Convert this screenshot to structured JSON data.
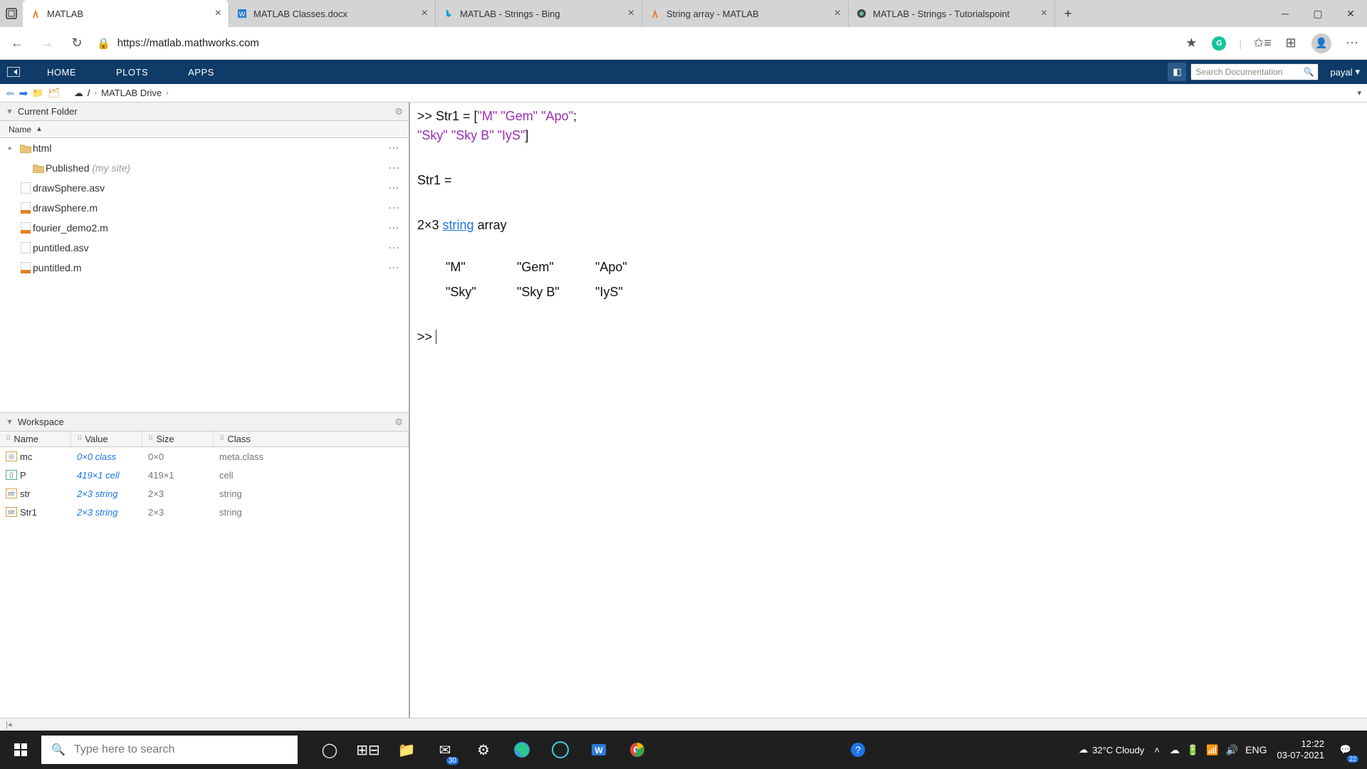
{
  "browser": {
    "tabs": [
      {
        "title": "MATLAB",
        "active": true
      },
      {
        "title": "MATLAB Classes.docx",
        "active": false
      },
      {
        "title": "MATLAB - Strings - Bing",
        "active": false
      },
      {
        "title": "String array - MATLAB",
        "active": false
      },
      {
        "title": "MATLAB - Strings - Tutorialspoint",
        "active": false
      }
    ],
    "url": "https://matlab.mathworks.com"
  },
  "matlab": {
    "tabs": [
      "HOME",
      "PLOTS",
      "APPS"
    ],
    "search_placeholder": "Search Documentation",
    "user": "payal",
    "breadcrumb": "MATLAB Drive"
  },
  "panels": {
    "current_folder": {
      "title": "Current Folder",
      "column": "Name"
    },
    "workspace": {
      "title": "Workspace",
      "columns": [
        "Name",
        "Value",
        "Size",
        "Class"
      ]
    }
  },
  "files": [
    {
      "name": "html",
      "type": "folder",
      "expandable": true
    },
    {
      "name": "Published",
      "hint": "(my site)",
      "type": "folder",
      "expandable": false,
      "indent": true
    },
    {
      "name": "drawSphere.asv",
      "type": "file"
    },
    {
      "name": "drawSphere.m",
      "type": "m"
    },
    {
      "name": "fourier_demo2.m",
      "type": "m"
    },
    {
      "name": "puntitled.asv",
      "type": "file"
    },
    {
      "name": "puntitled.m",
      "type": "m"
    }
  ],
  "workspace_vars": [
    {
      "name": "mc",
      "value": "0×0 class",
      "size": "0×0",
      "class": "meta.class",
      "icon": "obj"
    },
    {
      "name": "P",
      "value": "419×1 cell",
      "size": "419×1",
      "class": "cell",
      "icon": "cell"
    },
    {
      "name": "str",
      "value": "2×3 string",
      "size": "2×3",
      "class": "string",
      "icon": "str"
    },
    {
      "name": "Str1",
      "value": "2×3 string",
      "size": "2×3",
      "class": "string",
      "icon": "str"
    }
  ],
  "command": {
    "line1_pre": ">> Str1 = [",
    "line1_strings": [
      "\"M\"",
      "\"Gem\"",
      "\"Apo\""
    ],
    "line1_post": ";",
    "line2_strings": [
      "\"Sky\"",
      "\"Sky B\"",
      "\"IyS\""
    ],
    "line2_post": "]",
    "out1": "Str1 = ",
    "out2_pre": "  2×3 ",
    "out2_link": "string",
    "out2_post": " array",
    "row1": [
      "\"M\"",
      "\"Gem\"",
      "\"Apo\""
    ],
    "row2": [
      "\"Sky\"",
      "\"Sky B\"",
      "\"IyS\""
    ],
    "prompt": ">> "
  },
  "taskbar": {
    "search_placeholder": "Type here to search",
    "weather": "32°C Cloudy",
    "lang": "ENG",
    "time": "12:22",
    "date": "03-07-2021",
    "mail_badge": "30",
    "notif_badge": "22"
  }
}
